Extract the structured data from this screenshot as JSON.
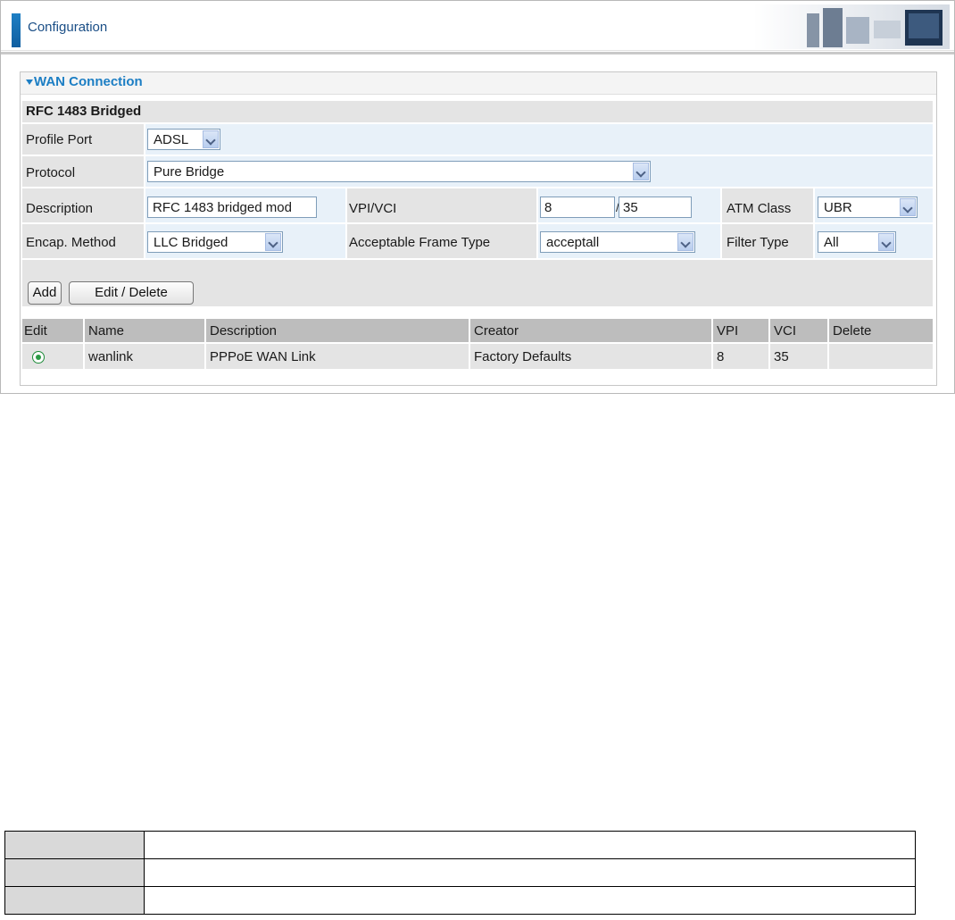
{
  "header": {
    "title": "Configuration"
  },
  "section": {
    "title": "WAN Connection",
    "subtitle": "RFC 1483 Bridged"
  },
  "form": {
    "profile_port": {
      "label": "Profile Port",
      "value": "ADSL"
    },
    "protocol": {
      "label": "Protocol",
      "value": "Pure Bridge"
    },
    "description": {
      "label": "Description",
      "value": "RFC 1483 bridged mod"
    },
    "vpi_vci": {
      "label": "VPI/VCI",
      "vpi": "8",
      "separator": "/",
      "vci": "35"
    },
    "atm_class": {
      "label": "ATM Class",
      "value": "UBR"
    },
    "encap_method": {
      "label": "Encap. Method",
      "value": "LLC Bridged"
    },
    "acceptable_frame_type": {
      "label": "Acceptable Frame Type",
      "value": "acceptall"
    },
    "filter_type": {
      "label": "Filter Type",
      "value": "All"
    }
  },
  "buttons": {
    "add": "Add",
    "edit_delete": "Edit / Delete"
  },
  "table": {
    "columns": [
      "Edit",
      "Name",
      "Description",
      "Creator",
      "VPI",
      "VCI",
      "Delete"
    ],
    "rows": [
      {
        "selected": true,
        "name": "wanlink",
        "description": "PPPoE WAN Link",
        "creator": "Factory Defaults",
        "vpi": "8",
        "vci": "35",
        "delete": ""
      }
    ]
  },
  "colors": {
    "accent": "#1c7ec4",
    "label_bg": "#e4e4e4",
    "field_row_bg": "#e8f1f9"
  }
}
